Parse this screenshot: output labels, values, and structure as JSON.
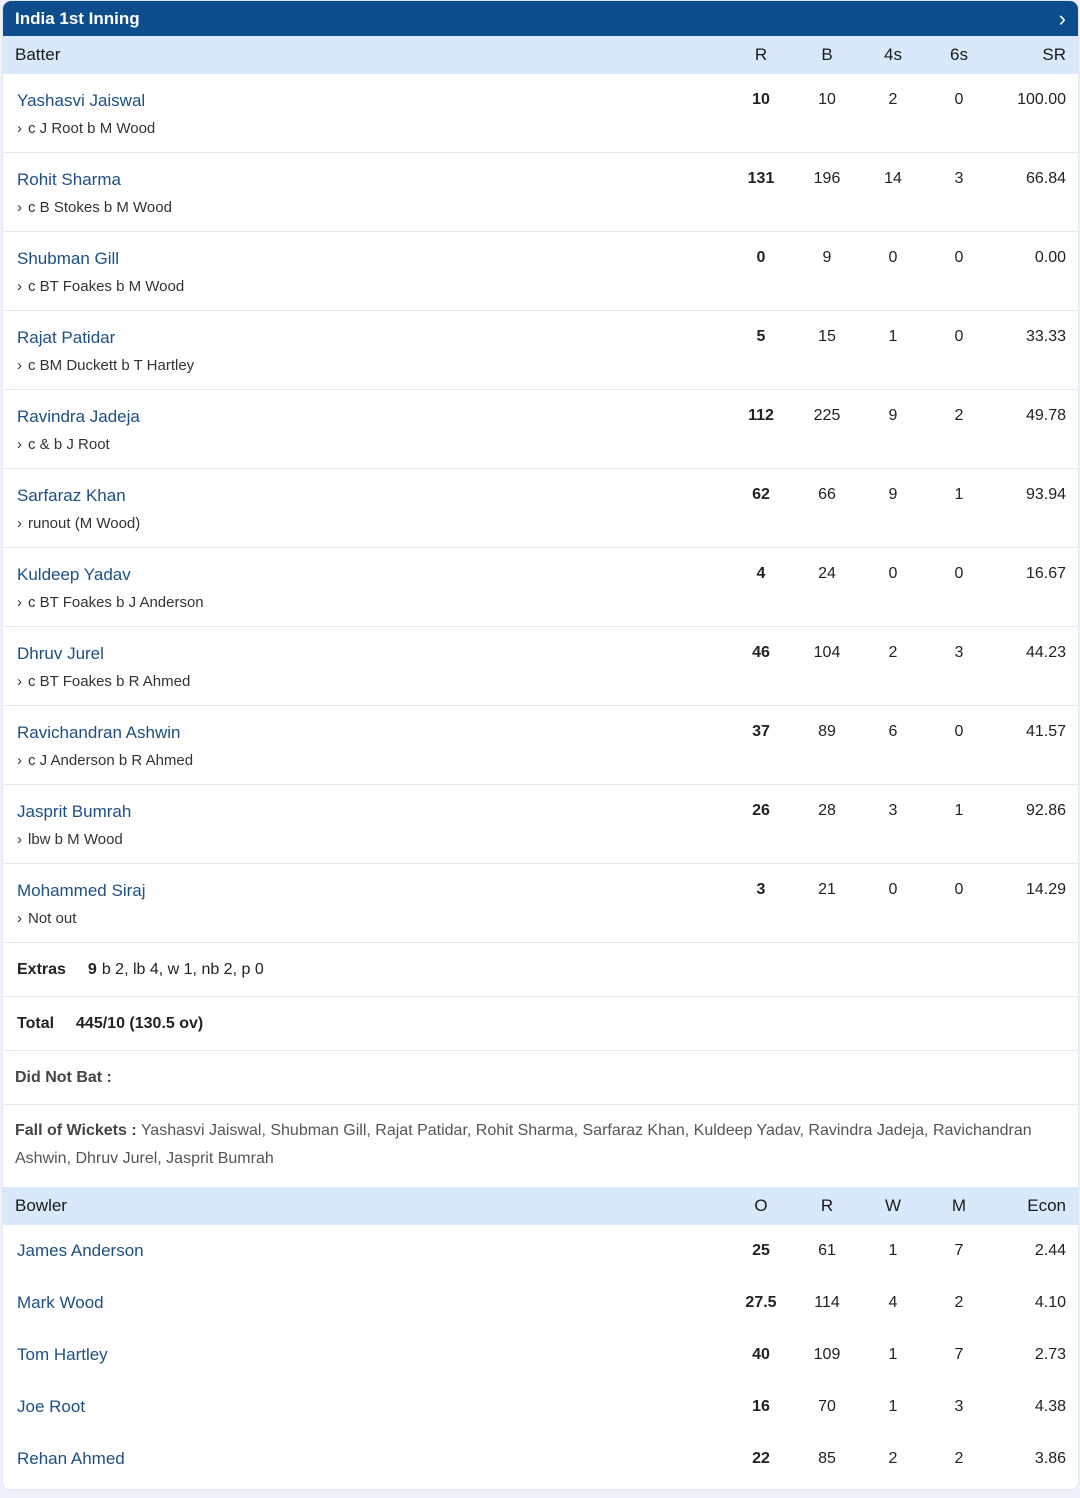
{
  "header": {
    "title": "India 1st Inning",
    "chevron_icon": "chevron-right-icon"
  },
  "batting": {
    "columns": [
      "Batter",
      "R",
      "B",
      "4s",
      "6s",
      "SR"
    ],
    "rows": [
      {
        "name": "Yashasvi Jaiswal",
        "dismissal": "c J Root b M Wood",
        "r": "10",
        "b": "10",
        "fours": "2",
        "sixes": "0",
        "sr": "100.00"
      },
      {
        "name": "Rohit Sharma",
        "dismissal": "c B Stokes b M Wood",
        "r": "131",
        "b": "196",
        "fours": "14",
        "sixes": "3",
        "sr": "66.84"
      },
      {
        "name": "Shubman Gill",
        "dismissal": "c BT Foakes b M Wood",
        "r": "0",
        "b": "9",
        "fours": "0",
        "sixes": "0",
        "sr": "0.00"
      },
      {
        "name": "Rajat Patidar",
        "dismissal": "c BM Duckett b T Hartley",
        "r": "5",
        "b": "15",
        "fours": "1",
        "sixes": "0",
        "sr": "33.33"
      },
      {
        "name": "Ravindra Jadeja",
        "dismissal": "c & b J Root",
        "r": "112",
        "b": "225",
        "fours": "9",
        "sixes": "2",
        "sr": "49.78"
      },
      {
        "name": "Sarfaraz Khan",
        "dismissal": "runout (M Wood)",
        "r": "62",
        "b": "66",
        "fours": "9",
        "sixes": "1",
        "sr": "93.94"
      },
      {
        "name": "Kuldeep Yadav",
        "dismissal": "c BT Foakes b J Anderson",
        "r": "4",
        "b": "24",
        "fours": "0",
        "sixes": "0",
        "sr": "16.67"
      },
      {
        "name": "Dhruv Jurel",
        "dismissal": "c BT Foakes b R Ahmed",
        "r": "46",
        "b": "104",
        "fours": "2",
        "sixes": "3",
        "sr": "44.23"
      },
      {
        "name": "Ravichandran Ashwin",
        "dismissal": "c J Anderson b R Ahmed",
        "r": "37",
        "b": "89",
        "fours": "6",
        "sixes": "0",
        "sr": "41.57"
      },
      {
        "name": "Jasprit Bumrah",
        "dismissal": "lbw b M Wood",
        "r": "26",
        "b": "28",
        "fours": "3",
        "sixes": "1",
        "sr": "92.86"
      },
      {
        "name": "Mohammed Siraj",
        "dismissal": "Not out",
        "r": "3",
        "b": "21",
        "fours": "0",
        "sixes": "0",
        "sr": "14.29"
      }
    ]
  },
  "extras": {
    "label": "Extras",
    "total": "9",
    "detail": "b 2, lb 4, w 1, nb 2, p 0"
  },
  "total": {
    "label": "Total",
    "value": "445/10 (130.5 ov)"
  },
  "did_not_bat": {
    "label": "Did Not Bat :"
  },
  "fall_of_wickets": {
    "label": "Fall of Wickets :",
    "text": "Yashasvi Jaiswal, Shubman Gill, Rajat Patidar, Rohit Sharma, Sarfaraz Khan, Kuldeep Yadav, Ravindra Jadeja, Ravichandran Ashwin, Dhruv Jurel, Jasprit Bumrah"
  },
  "bowling": {
    "columns": [
      "Bowler",
      "O",
      "R",
      "W",
      "M",
      "Econ"
    ],
    "rows": [
      {
        "name": "James Anderson",
        "o": "25",
        "r": "61",
        "w": "1",
        "m": "7",
        "econ": "2.44"
      },
      {
        "name": "Mark Wood",
        "o": "27.5",
        "r": "114",
        "w": "4",
        "m": "2",
        "econ": "4.10"
      },
      {
        "name": "Tom Hartley",
        "o": "40",
        "r": "109",
        "w": "1",
        "m": "7",
        "econ": "2.73"
      },
      {
        "name": "Joe Root",
        "o": "16",
        "r": "70",
        "w": "1",
        "m": "3",
        "econ": "4.38"
      },
      {
        "name": "Rehan Ahmed",
        "o": "22",
        "r": "85",
        "w": "2",
        "m": "2",
        "econ": "3.86"
      }
    ]
  }
}
